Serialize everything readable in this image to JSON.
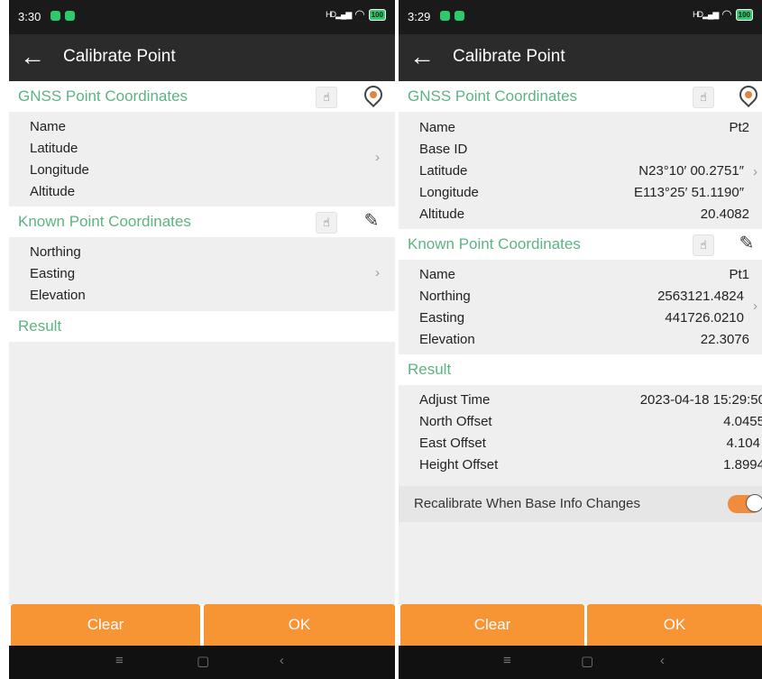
{
  "colors": {
    "accent_green": "#5cb483",
    "orange": "#f79434",
    "app_bar": "#2b2b2b"
  },
  "left": {
    "status": {
      "time": "3:30",
      "signal": "HD",
      "battery": "100"
    },
    "app_bar": {
      "title": "Calibrate Point"
    },
    "gnss": {
      "title": "GNSS Point Coordinates",
      "rows": [
        "Name",
        "Latitude",
        "Longitude",
        "Altitude"
      ]
    },
    "known": {
      "title": "Known Point Coordinates",
      "rows": [
        "Northing",
        "Easting",
        "Elevation"
      ]
    },
    "result": {
      "title": "Result"
    },
    "buttons": {
      "clear": "Clear",
      "ok": "OK"
    }
  },
  "right": {
    "status": {
      "time": "3:29",
      "signal": "HD",
      "battery": "100"
    },
    "app_bar": {
      "title": "Calibrate Point"
    },
    "gnss": {
      "title": "GNSS Point Coordinates",
      "rows": [
        {
          "label": "Name",
          "value": "Pt2"
        },
        {
          "label": "Base ID",
          "value": ""
        },
        {
          "label": "Latitude",
          "value": "N23°10′ 00.2751″"
        },
        {
          "label": "Longitude",
          "value": "E113°25′ 51.1190″"
        },
        {
          "label": "Altitude",
          "value": "20.4082"
        }
      ]
    },
    "known": {
      "title": "Known Point Coordinates",
      "rows": [
        {
          "label": "Name",
          "value": "Pt1"
        },
        {
          "label": "Northing",
          "value": "2563121.4824"
        },
        {
          "label": "Easting",
          "value": "441726.0210"
        },
        {
          "label": "Elevation",
          "value": "22.3076"
        }
      ]
    },
    "result": {
      "title": "Result",
      "rows": [
        {
          "label": "Adjust Time",
          "value": "2023-04-18 15:29:50"
        },
        {
          "label": "North Offset",
          "value": "4.0455"
        },
        {
          "label": "East Offset",
          "value": "4.104"
        },
        {
          "label": "Height Offset",
          "value": "1.8994"
        }
      ]
    },
    "toggle": {
      "label": "Recalibrate When Base Info Changes",
      "on": true
    },
    "buttons": {
      "clear": "Clear",
      "ok": "OK"
    }
  },
  "icons": {
    "back": "back-arrow-icon",
    "pick": "pick-point-icon",
    "location": "location-pin-icon",
    "edit": "edit-icon",
    "chevron": "chevron-right-icon",
    "nav_menu": "menu-icon",
    "nav_home": "home-icon",
    "nav_back": "back-icon"
  }
}
